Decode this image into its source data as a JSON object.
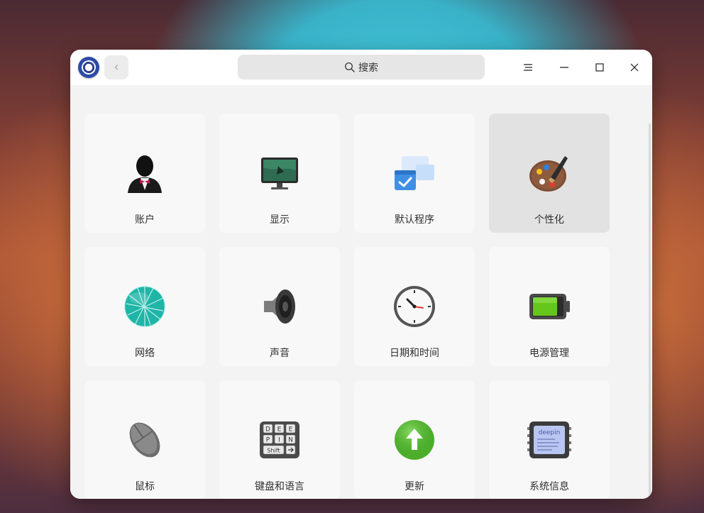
{
  "window": {
    "search_placeholder": "搜索",
    "titlebar_icons": {
      "app": "control-center-logo",
      "back": "chevron-left-icon",
      "menu": "menu-icon",
      "minimize": "minimize-icon",
      "maximize": "maximize-icon",
      "close": "close-icon"
    }
  },
  "modules": [
    {
      "label": "账户",
      "icon": "account-icon",
      "selected": false
    },
    {
      "label": "显示",
      "icon": "display-icon",
      "selected": false
    },
    {
      "label": "默认程序",
      "icon": "default-apps-icon",
      "selected": false
    },
    {
      "label": "个性化",
      "icon": "personalization-icon",
      "selected": true
    },
    {
      "label": "网络",
      "icon": "network-icon",
      "selected": false
    },
    {
      "label": "声音",
      "icon": "sound-icon",
      "selected": false
    },
    {
      "label": "日期和时间",
      "icon": "datetime-icon",
      "selected": false
    },
    {
      "label": "电源管理",
      "icon": "power-icon",
      "selected": false
    },
    {
      "label": "鼠标",
      "icon": "mouse-icon",
      "selected": false
    },
    {
      "label": "键盘和语言",
      "icon": "keyboard-icon",
      "selected": false
    },
    {
      "label": "更新",
      "icon": "update-icon",
      "selected": false
    },
    {
      "label": "系统信息",
      "icon": "system-info-icon",
      "selected": false
    }
  ],
  "keyboard_keys": [
    "D",
    "E",
    "E",
    "P",
    "I",
    "N",
    "Shift"
  ],
  "system_info_text": "deepin",
  "accent_colors": {
    "selected_card": "#e2e2e2",
    "card": "#f8f8f8",
    "window_bg": "#f3f3f3"
  }
}
